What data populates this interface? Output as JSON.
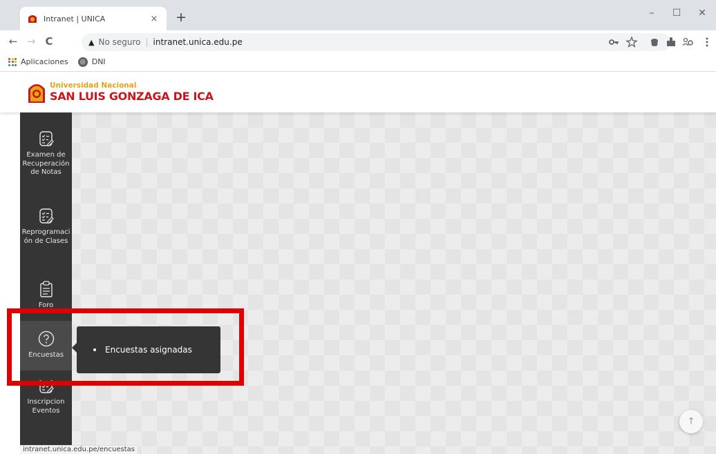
{
  "browser": {
    "tab_title": "Intranet | UNICA",
    "tab_close": "×",
    "new_tab": "+",
    "window_controls": {
      "minimize": "–",
      "maximize": "☐",
      "close": "✕"
    },
    "nav": {
      "back": "←",
      "forward": "→",
      "reload": "C"
    },
    "omnibox": {
      "warning_icon": "▲",
      "insecure_label": "No seguro",
      "url": "intranet.unica.edu.pe"
    },
    "toolbar_icons": [
      "key-icon",
      "star-icon",
      "extension-icon",
      "puzzle-icon",
      "profile-icon",
      "menu-icon"
    ],
    "bookmarks": [
      {
        "label": "Aplicaciones",
        "icon": "apps-icon"
      },
      {
        "label": "DNI",
        "icon": "globe-icon"
      }
    ],
    "status_url": "intranet.unica.edu.pe/encuestas"
  },
  "header": {
    "uni_top": "Universidad Nacional",
    "uni_bottom": "SAN LUIS GONZAGA DE ICA",
    "colors": {
      "gold": "#e8a215",
      "red": "#c8161d"
    }
  },
  "sidebar": {
    "items": [
      {
        "label": "Examen de Recuperación de Notas",
        "icon": "checklist-edit-icon"
      },
      {
        "label": "Reprogramación de Clases",
        "icon": "checklist-edit-icon"
      },
      {
        "label": "Foro",
        "icon": "clipboard-icon"
      },
      {
        "label": "Encuestas",
        "icon": "question-circle-icon",
        "active": true
      },
      {
        "label": "Inscripcion Eventos",
        "icon": "checklist-edit-icon"
      }
    ]
  },
  "submenu": {
    "items": [
      {
        "label": "Encuestas asignadas"
      }
    ]
  },
  "scroll_top": "↑"
}
